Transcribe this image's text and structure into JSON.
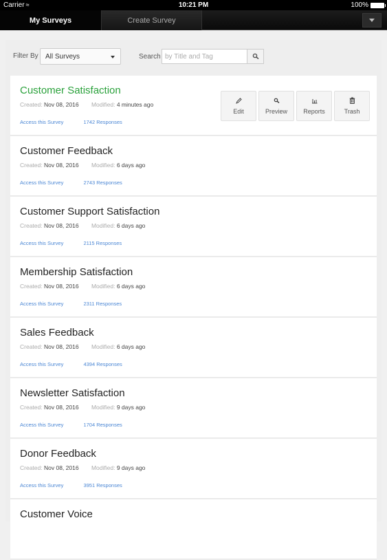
{
  "status_bar": {
    "carrier": "Carrier",
    "time": "10:21 PM",
    "battery": "100%"
  },
  "nav": {
    "tabs": [
      {
        "label": "My Surveys",
        "active": true
      },
      {
        "label": "Create Survey",
        "active": false
      }
    ],
    "menu_icon": "caret-down-icon"
  },
  "filter": {
    "label": "Filter By",
    "selected": "All Surveys",
    "search_label": "Search",
    "search_placeholder": "by Title and Tag",
    "search_value": ""
  },
  "labels": {
    "created": "Created:",
    "modified": "Modified:",
    "access": "Access this Survey"
  },
  "actions": [
    {
      "label": "Edit",
      "icon": "pencil-icon"
    },
    {
      "label": "Preview",
      "icon": "magnifier-icon"
    },
    {
      "label": "Reports",
      "icon": "bar-chart-icon"
    },
    {
      "label": "Trash",
      "icon": "trash-icon"
    }
  ],
  "accent_color": "#2aa13b",
  "link_color": "#4a86d4",
  "surveys": [
    {
      "title": "Customer Satisfaction",
      "created": "Nov 08, 2016",
      "modified": "4 minutes ago",
      "responses": "1742 Responses",
      "active": true
    },
    {
      "title": "Customer Feedback",
      "created": "Nov 08, 2016",
      "modified": "6 days ago",
      "responses": "2743 Responses"
    },
    {
      "title": "Customer Support Satisfaction",
      "created": "Nov 08, 2016",
      "modified": "6 days ago",
      "responses": "2115 Responses"
    },
    {
      "title": "Membership Satisfaction",
      "created": "Nov 08, 2016",
      "modified": "6 days ago",
      "responses": "2311 Responses"
    },
    {
      "title": "Sales Feedback",
      "created": "Nov 08, 2016",
      "modified": "6 days ago",
      "responses": "4394 Responses"
    },
    {
      "title": "Newsletter Satisfaction",
      "created": "Nov 08, 2016",
      "modified": "9 days ago",
      "responses": "1704 Responses"
    },
    {
      "title": "Donor Feedback",
      "created": "Nov 08, 2016",
      "modified": "9 days ago",
      "responses": "3951 Responses"
    },
    {
      "title": "Customer Voice",
      "created": "",
      "modified": "",
      "responses": ""
    }
  ]
}
